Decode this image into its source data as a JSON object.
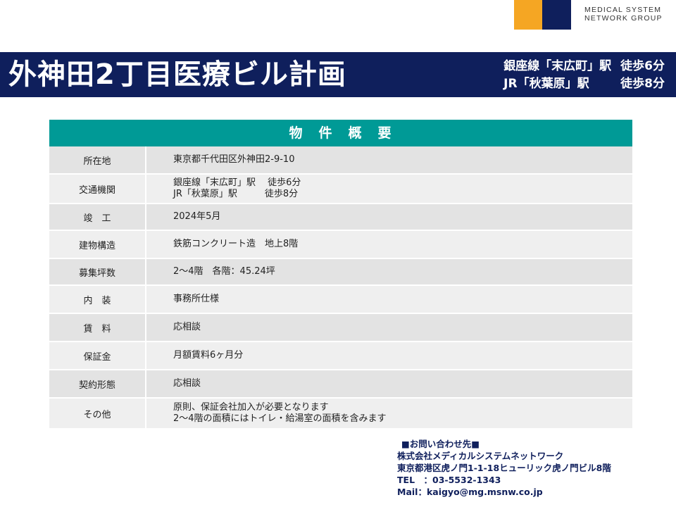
{
  "logo": {
    "line1": "MEDICAL SYSTEM",
    "line2": "NETWORK GROUP",
    "colors": {
      "orange": "#F5A623",
      "navy": "#0F1F5C"
    }
  },
  "title": "外神田2丁目医療ビル計画",
  "access": [
    {
      "station": "銀座線「末広町」駅",
      "walk": "徒歩6分"
    },
    {
      "station": "JR「秋葉原」駅",
      "walk": "徒歩8分"
    }
  ],
  "table": {
    "heading": "物　件　概　要",
    "header_color": "#009A96",
    "rows": [
      {
        "label": "所在地",
        "value": [
          "東京都千代田区外神田2-9-10"
        ]
      },
      {
        "label": "交通機関",
        "value": [
          "銀座線「末広町」駅　 徒歩6分",
          "JR「秋葉原」駅　　　徒歩8分"
        ]
      },
      {
        "label": "竣　工",
        "value": [
          "2024年5月"
        ]
      },
      {
        "label": "建物構造",
        "value": [
          "鉄筋コンクリート造　地上8階"
        ]
      },
      {
        "label": "募集坪数",
        "value": [
          "2～4階　各階：45.24坪"
        ]
      },
      {
        "label": "内　装",
        "value": [
          "事務所仕様"
        ]
      },
      {
        "label": "賃　料",
        "value": [
          "応相談"
        ]
      },
      {
        "label": "保証金",
        "value": [
          "月額賃料6ヶ月分"
        ]
      },
      {
        "label": "契約形態",
        "value": [
          "応相談"
        ]
      },
      {
        "label": "その他",
        "value": [
          "原則、保証会社加入が必要となります",
          "2～4階の面積にはトイレ・給湯室の面積を含みます"
        ]
      }
    ]
  },
  "contact": {
    "heading": "■お問い合わせ先■",
    "company": "株式会社メディカルシステムネットワーク",
    "address": "東京都港区虎ノ門1-1-18ヒューリック虎ノ門ビル8階",
    "tel": "TEL　：03-5532-1343",
    "mail": "Mail：kaigyo@mg.msnw.co.jp"
  }
}
